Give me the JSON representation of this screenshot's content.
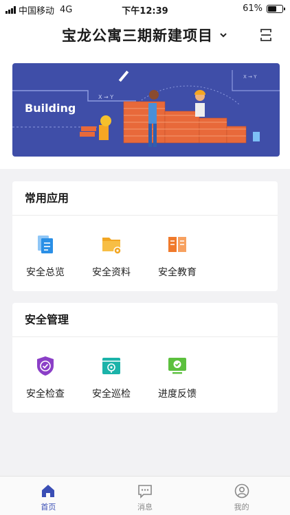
{
  "status_bar": {
    "carrier": "中国移动",
    "network": "4G",
    "time": "下午12:39",
    "battery": "61%"
  },
  "header": {
    "title": "宝龙公寓三期新建项目"
  },
  "banner": {
    "text": "Building"
  },
  "common_apps": {
    "title": "常用应用",
    "items": [
      {
        "label": "安全总览",
        "icon": "document-copy-icon",
        "color": "#2a8fe6"
      },
      {
        "label": "安全资料",
        "icon": "folder-icon",
        "color": "#f2a623"
      },
      {
        "label": "安全教育",
        "icon": "book-icon",
        "color": "#f07a2b"
      }
    ]
  },
  "safety_mgmt": {
    "title": "安全管理",
    "items": [
      {
        "label": "安全检查",
        "icon": "shield-check-icon",
        "color": "#8b3fc7"
      },
      {
        "label": "安全巡检",
        "icon": "patrol-screen-icon",
        "color": "#1bb3a9"
      },
      {
        "label": "进度反馈",
        "icon": "monitor-check-icon",
        "color": "#5cc03e"
      }
    ]
  },
  "tabbar": {
    "items": [
      {
        "label": "首页",
        "icon": "home-icon",
        "active": true
      },
      {
        "label": "消息",
        "icon": "message-icon",
        "active": false
      },
      {
        "label": "我的",
        "icon": "user-icon",
        "active": false
      }
    ]
  },
  "colors": {
    "accent": "#3a4eb5",
    "banner_bg": "#3f4ea8"
  }
}
